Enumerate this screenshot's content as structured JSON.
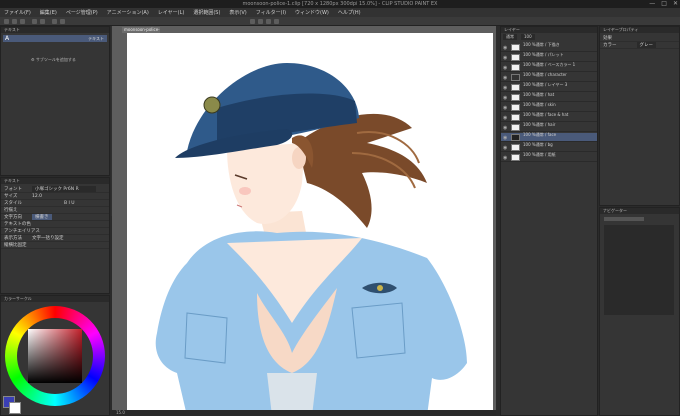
{
  "window": {
    "title": "moonsoon-police-1.clip [720 x 1280px 300dpi 15.0%] - CLIP STUDIO PAINT EX",
    "controls": [
      "—",
      "□",
      "✕"
    ]
  },
  "menu": [
    "ファイル(F)",
    "編集(E)",
    "ページ管理(P)",
    "アニメーション(A)",
    "レイヤー(L)",
    "選択範囲(S)",
    "表示(V)",
    "フィルター(I)",
    "ウィンドウ(W)",
    "ヘルプ(H)"
  ],
  "tool_panel": {
    "title": "テキスト",
    "tool_label": "A",
    "tool_value": "テキスト",
    "add_label": "サブツールを追加する"
  },
  "text_props": {
    "title": "テキスト",
    "rows": [
      {
        "label": "フォント",
        "value": "小塚ゴシック Pr6N R"
      },
      {
        "label": "サイズ",
        "value": "12.0"
      },
      {
        "label": "スタイル",
        "value": "B I U"
      },
      {
        "label": "行揃え",
        "value": ""
      },
      {
        "label": "文字方向",
        "value": "横書き"
      },
      {
        "label": "テキストの色",
        "value": ""
      },
      {
        "label": "アンチエイリアス",
        "value": ""
      },
      {
        "label": "表示方法",
        "value": "文字一括り設定"
      },
      {
        "label": "縦横比固定",
        "value": ""
      }
    ]
  },
  "color_panel": {
    "title": "カラーサークル",
    "main_color": "#3a3fb5",
    "sub_color": "#ffffff",
    "wheel_hue": "#c21f2a"
  },
  "canvas": {
    "tab_label": "moonsoon-police-1.clip"
  },
  "layer_panel": {
    "title": "レイヤー",
    "blend_mode": "通常",
    "opacity": "100",
    "layers": [
      {
        "name": "100 %通常 / 下描き",
        "selected": false
      },
      {
        "name": "100 %通常 / パレット",
        "selected": false
      },
      {
        "name": "100 %通常 / ベースカラー 1",
        "selected": false
      },
      {
        "name": "100 %通常 / character",
        "selected": false
      },
      {
        "name": "100 %通常 / レイヤー 3",
        "selected": false
      },
      {
        "name": "100 %通常 / hat",
        "selected": false
      },
      {
        "name": "100 %通常 / skin",
        "selected": false
      },
      {
        "name": "100 %通常 / face & hat",
        "selected": false
      },
      {
        "name": "100 %通常 / hair",
        "selected": false
      },
      {
        "name": "100 %通常 / face",
        "selected": true
      },
      {
        "name": "100 %通常 / bg",
        "selected": false
      },
      {
        "name": "100 %通常 / 用紙",
        "selected": false
      }
    ]
  },
  "right_panel": {
    "title": "レイヤープロパティ",
    "effect_label": "効果",
    "color_label": "カラー",
    "mode_label": "グレー"
  },
  "nav_panel": {
    "title": "ナビゲーター",
    "zoom": "15.0"
  },
  "misc_icons": [
    "pen-icon",
    "eraser-icon",
    "fill-icon",
    "move-icon",
    "select-icon",
    "eyedropper-icon",
    "text-icon"
  ]
}
